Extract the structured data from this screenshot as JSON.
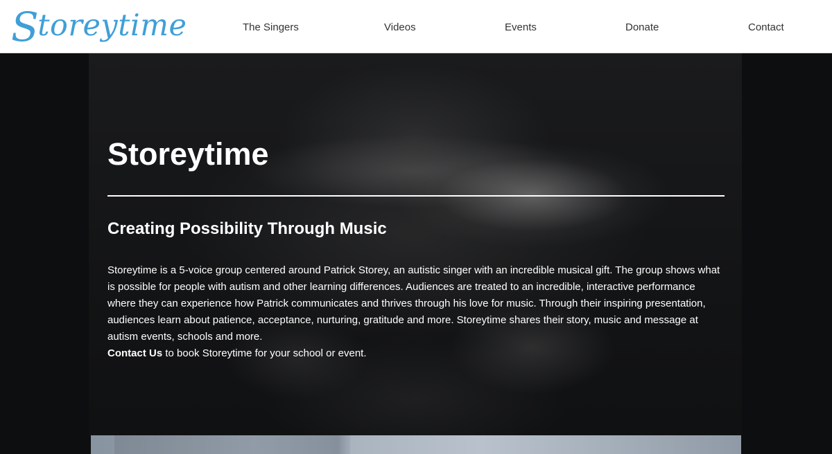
{
  "logo": {
    "initial": "S",
    "rest": "toreytime"
  },
  "nav": {
    "items": [
      {
        "label": "The Singers"
      },
      {
        "label": "Videos"
      },
      {
        "label": "Events"
      },
      {
        "label": "Donate"
      },
      {
        "label": "Contact"
      }
    ]
  },
  "hero": {
    "title": "Storeytime",
    "subtitle": "Creating Possibility Through Music",
    "description": "Storeytime is a 5-voice group centered around Patrick Storey, an autistic singer with an incredible musical gift. The group shows what is possible for people with autism and other learning differences. Audiences are treated to an incredible, interactive performance where they can experience how Patrick communicates and thrives through his love for music. Through their inspiring presentation, audiences learn about patience, acceptance, nurturing, gratitude and more. Storeytime shares their story, music and message at autism events, schools and more.",
    "cta_link": "Contact Us",
    "cta_text": " to book Storeytime for your school or event."
  },
  "colors": {
    "brand": "#3f9fd8",
    "nav_text": "#333333",
    "hero_bg": "#0d0e0f"
  }
}
